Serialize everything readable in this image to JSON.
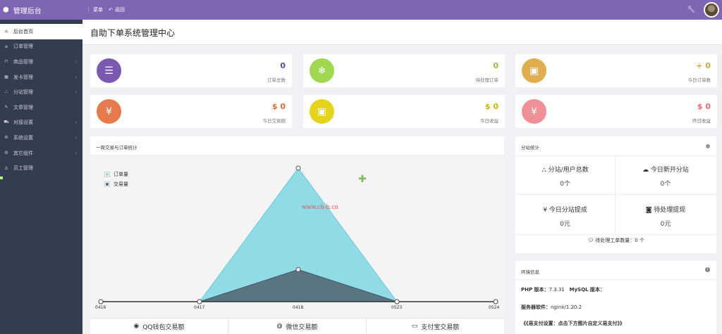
{
  "top": {
    "brand": "管理后台",
    "menu": "菜单",
    "back": "返回"
  },
  "sidebar": {
    "items": [
      {
        "label": "后台首页",
        "icon": "home-icon",
        "chevron": false
      },
      {
        "label": "订单管理",
        "icon": "list-icon",
        "chevron": false
      },
      {
        "label": "商品管理",
        "icon": "cart-icon",
        "chevron": true
      },
      {
        "label": "发卡管理",
        "icon": "grid-icon",
        "chevron": true
      },
      {
        "label": "分站管理",
        "icon": "sitemap-icon",
        "chevron": true
      },
      {
        "label": "文章管理",
        "icon": "edit-icon",
        "chevron": false
      },
      {
        "label": "对接设置",
        "icon": "truck-icon",
        "chevron": true
      },
      {
        "label": "系统设置",
        "icon": "gear-icon",
        "chevron": true
      },
      {
        "label": "其它组件",
        "icon": "cogs-icon",
        "chevron": true
      },
      {
        "label": "员工管理",
        "icon": "anchor-icon",
        "chevron": false
      }
    ]
  },
  "page": {
    "title": "自助下单系统管理中心"
  },
  "cards": [
    {
      "value": "0",
      "label": "订单总数",
      "color": "#7b59b0",
      "valcolor": "#5b4a9a",
      "icon": "list-number-icon",
      "glyph": "☰"
    },
    {
      "value": "0",
      "label": "待处理订单",
      "color": "#9fd84f",
      "valcolor": "#8cc63f",
      "icon": "snowflake-icon",
      "glyph": "❄"
    },
    {
      "value": "+ 0",
      "label": "今日订单数",
      "color": "#dfae4f",
      "valcolor": "#d9a441",
      "icon": "briefcase-icon",
      "glyph": "▣"
    },
    {
      "value": "$ 0",
      "label": "今日交易额",
      "color": "#e67a4d",
      "valcolor": "#e06a3c",
      "icon": "yen-icon",
      "glyph": "¥"
    },
    {
      "value": "$ 0",
      "label": "今日收益",
      "color": "#e5d41a",
      "valcolor": "#c9b800",
      "icon": "briefcase-icon",
      "glyph": "▣"
    },
    {
      "value": "$ 0",
      "label": "昨日收益",
      "color": "#ef8f96",
      "valcolor": "#e86b73",
      "icon": "yen-icon",
      "glyph": "¥"
    }
  ],
  "chart_panel": {
    "title": "一周交易与订单统计",
    "watermark": "www.ch-h.cn",
    "pay_tabs": [
      {
        "label": "QQ钱包交易额",
        "icon": "qq-icon",
        "glyph": "◉"
      },
      {
        "label": "微信交易额",
        "icon": "wechat-icon",
        "glyph": "◍"
      },
      {
        "label": "支付宝交易额",
        "icon": "card-icon",
        "glyph": "▭"
      }
    ]
  },
  "chart_data": {
    "type": "area",
    "categories": [
      "0416",
      "0417",
      "0418",
      "0523",
      "0524"
    ],
    "series": [
      {
        "name": "订单量",
        "values": [
          0,
          0,
          1,
          0,
          0
        ],
        "color": "#90dbe6"
      },
      {
        "name": "交易量",
        "values": [
          0,
          0,
          0.24,
          0,
          0
        ],
        "color": "#5a7482"
      }
    ],
    "xlabel": "",
    "ylabel": "",
    "ylim": [
      0,
      1
    ],
    "grid": false,
    "legend": "top-left"
  },
  "substation": {
    "title": "分站统计",
    "cells": [
      {
        "label": "分站/用户总数",
        "value": "0个",
        "icon": "sitemap-icon",
        "glyph": "⛬"
      },
      {
        "label": "今日新开分站",
        "value": "0个",
        "icon": "cloud-icon",
        "glyph": "☁"
      },
      {
        "label": "今日分站提成",
        "value": "0元",
        "icon": "yen-icon",
        "glyph": "¥"
      },
      {
        "label": "待处理提现",
        "value": "0元",
        "icon": "money-icon",
        "glyph": "◙"
      }
    ],
    "ticket": "待处理工单数量：0 个"
  },
  "env": {
    "title": "环境信息",
    "php_label": "PHP 版本：",
    "php_value": "7.3.31",
    "mysql_label": "MySQL 版本：",
    "server_label": "服务器软件：",
    "server_value": "nginx/1.20.2",
    "alipay_note": "《《易支付设置：点击下方图片自定义易支付》》"
  }
}
